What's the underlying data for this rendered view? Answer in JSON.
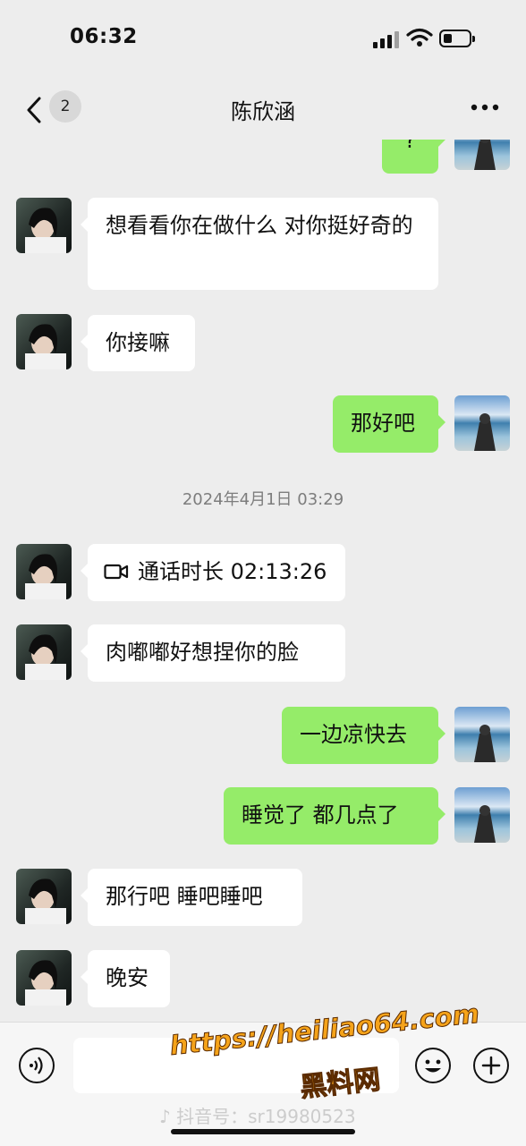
{
  "status_bar": {
    "time": "06:32"
  },
  "nav": {
    "unread_count": "2",
    "title": "陈欣涵"
  },
  "messages": [
    {
      "side": "right",
      "text": "?"
    },
    {
      "side": "left",
      "text": "想看看你在做什么 对你挺好奇的"
    },
    {
      "side": "left",
      "text": "你接嘛"
    },
    {
      "side": "right",
      "text": "那好吧"
    },
    {
      "side": "left",
      "text": "通话时长 02:13:26",
      "icon": "video-call-icon"
    },
    {
      "side": "left",
      "text": "肉嘟嘟好想捏你的脸"
    },
    {
      "side": "right",
      "text": "一边凉快去"
    },
    {
      "side": "right",
      "text": "睡觉了 都几点了"
    },
    {
      "side": "left",
      "text": "那行吧 睡吧睡吧"
    },
    {
      "side": "left",
      "text": "晚安"
    }
  ],
  "timestamp": "2024年4月1日 03:29",
  "watermark": {
    "url": "https://heiliao64.com",
    "name": "黑料网",
    "douyin": "抖音号：sr19980523"
  },
  "colors": {
    "bg": "#ededed",
    "outgoing_bubble": "#95ec69",
    "incoming_bubble": "#ffffff"
  }
}
